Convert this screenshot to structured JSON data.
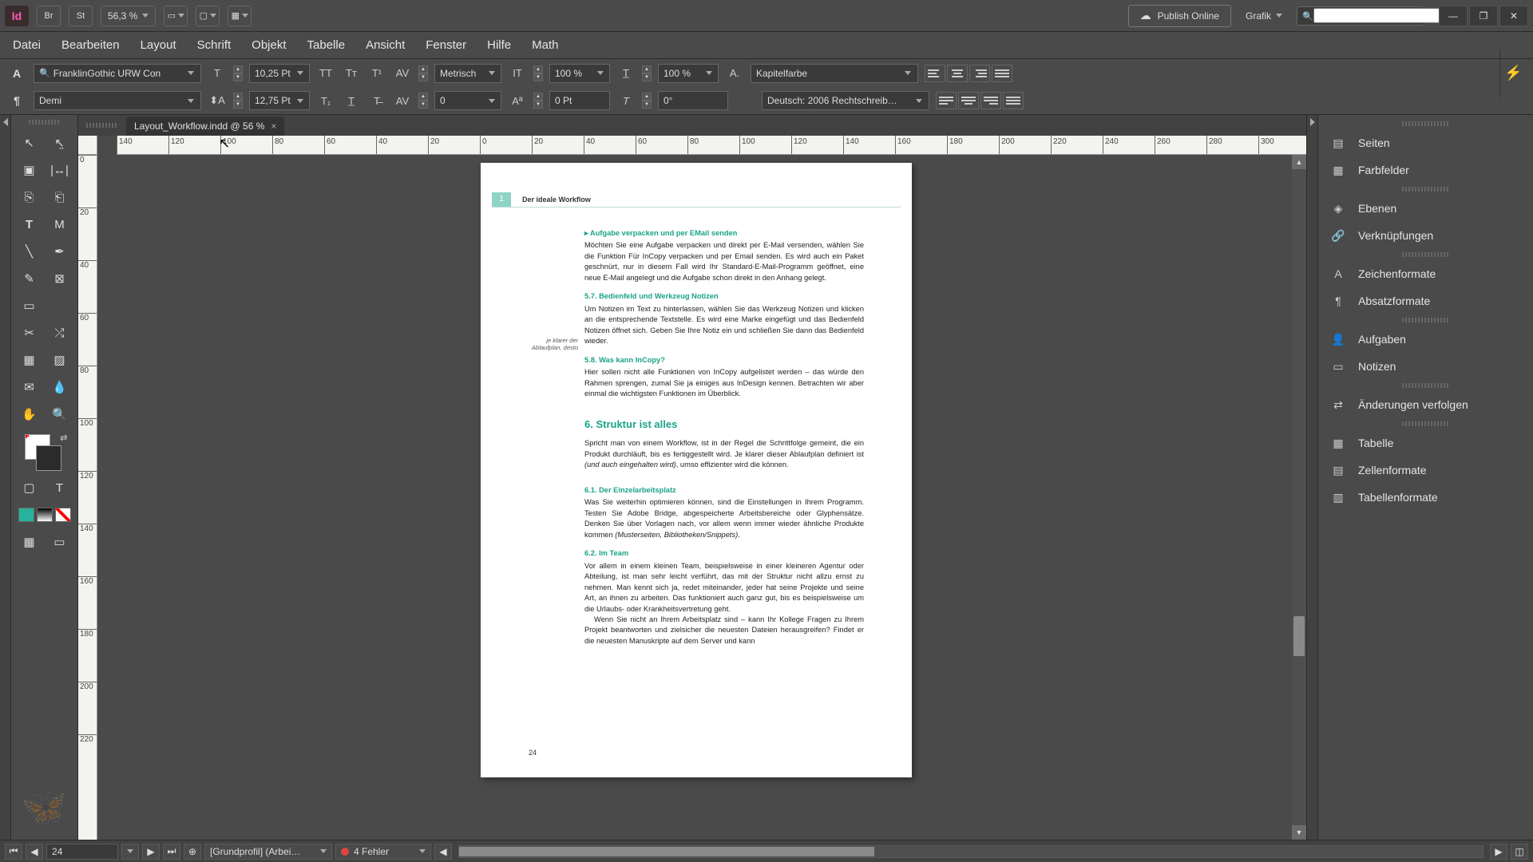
{
  "appbar": {
    "br_label": "Br",
    "st_label": "St",
    "zoom": "56,3 %",
    "publish_label": "Publish Online",
    "workspace_mode": "Grafik"
  },
  "menus": [
    "Datei",
    "Bearbeiten",
    "Layout",
    "Schrift",
    "Objekt",
    "Tabelle",
    "Ansicht",
    "Fenster",
    "Hilfe",
    "Math"
  ],
  "ctrl": {
    "font_family": "FranklinGothic URW Con",
    "font_style": "Demi",
    "font_size": "10,25 Pt",
    "leading": "12,75 Pt",
    "kerning": "Metrisch",
    "tracking": "0",
    "vscale": "100 %",
    "hscale": "100 %",
    "baseline": "0 Pt",
    "skew": "0°",
    "char_style": "Kapitelfarbe",
    "language": "Deutsch: 2006 Rechtschreib…"
  },
  "document": {
    "tab_title": "Layout_Workflow.indd @ 56 %",
    "ruler_h": [
      "140",
      "120",
      "100",
      "80",
      "60",
      "40",
      "20",
      "0",
      "20",
      "40",
      "60",
      "80",
      "100",
      "120",
      "140",
      "160",
      "180",
      "200",
      "220",
      "240",
      "260",
      "280",
      "300"
    ],
    "ruler_v": [
      "0",
      "20",
      "40",
      "60",
      "80",
      "100",
      "120",
      "140",
      "160",
      "180",
      "200",
      "220"
    ],
    "chapter_num": "1",
    "chapter_title": "Der ideale Workflow",
    "h1": "Aufgabe verpacken und per EMail senden",
    "p1": "Möchten Sie eine Aufgabe verpacken und direkt per E-Mail versenden, wählen Sie die Funktion Für InCopy verpacken und per Email senden. Es wird auch ein Paket geschnürt, nur in diesem Fall wird Ihr Standard-E-Mail-Programm geöffnet, eine neue E-Mail angelegt und die Aufgabe schon direkt in den Anhang gelegt.",
    "h2": "5.7.   Bedienfeld und Werkzeug Notizen",
    "p2": "Um Notizen im Text zu hinterlassen, wählen Sie das Werkzeug Notizen und klicken an die entsprechende Textstelle. Es wird eine Marke eingefügt und das Bedienfeld Notizen öffnet sich. Geben Sie Ihre Notiz ein und schließen Sie dann das Bedienfeld wieder.",
    "h3": "5.8.   Was kann InCopy?",
    "margin_note": "je klarer der Ablaufplan, desto",
    "p3": "Hier sollen nicht alle Funktionen von InCopy aufgelistet werden – das würde den Rahmen sprengen, zumal Sie ja einiges aus InDesign kennen. Betrachten wir aber einmal die wichtigsten Funktionen im Überblick.",
    "bigh": "6.   Struktur ist alles",
    "p4a": "Spricht man von einem Workflow, ist in der Regel die Schrittfolge gemeint, die ein Produkt durchläuft, bis es fertiggestellt wird. Je klarer dieser Ablaufplan definiert ist ",
    "p4i": "(und auch eingehalten wird)",
    "p4b": ", umso effizienter wird die können.",
    "h5": "6.1.   Der Einzelarbeitsplatz",
    "p5a": "Was Sie weiterhin optimieren können, sind die Einstellungen in Ihrem Programm. Testen Sie Adobe Bridge, abgespeicherte Arbeitsbereiche oder Glyphensätze. Denken Sie über Vorlagen nach, vor allem wenn immer wieder ähnliche Produkte kommen ",
    "p5i": "(Musterseiten, Bibliotheken/Snippets)",
    "p5b": ".",
    "h6": "6.2.   Im Team",
    "p6": "Vor allem in einem kleinen Team, beispielsweise in einer kleineren Agentur oder Abteilung, ist man sehr leicht verführt, das mit der Struktur nicht allzu ernst zu nehmen. Man kennt sich ja, redet miteinander, jeder hat seine Projekte und seine Art, an ihnen zu arbeiten. Das funktioniert auch ganz gut, bis es beispielsweise um die Urlaubs- oder Krankheitsvertretung geht.",
    "p6b": "Wenn Sie nicht an Ihrem Arbeitsplatz sind – kann Ihr Kollege Fragen zu Ihrem Projekt beantworten und zielsicher die neuesten Dateien herausgreifen? Findet er die neuesten Manuskripte auf dem Server und kann",
    "folio": "24"
  },
  "right_panels": {
    "g1": [
      "Seiten",
      "Farbfelder"
    ],
    "g2": [
      "Ebenen",
      "Verknüpfungen"
    ],
    "g3": [
      "Zeichenformate",
      "Absatzformate"
    ],
    "g4": [
      "Aufgaben",
      "Notizen"
    ],
    "g5": [
      "Änderungen verfolgen"
    ],
    "g6": [
      "Tabelle",
      "Zellenformate",
      "Tabellenformate"
    ]
  },
  "status": {
    "page": "24",
    "profile": "[Grundprofil] (Arbei…",
    "errors": "4 Fehler"
  }
}
